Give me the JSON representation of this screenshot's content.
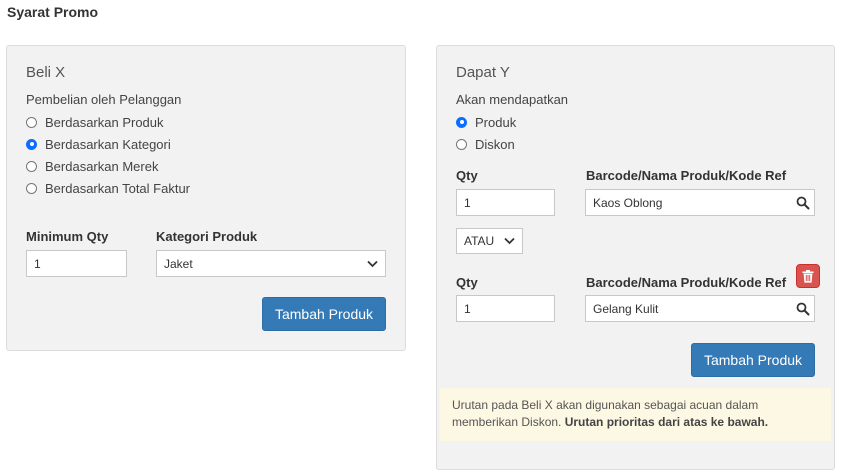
{
  "page": {
    "title": "Syarat Promo"
  },
  "beli_x": {
    "heading": "Beli X",
    "purchase_label": "Pembelian oleh Pelanggan",
    "options": [
      {
        "label": "Berdasarkan Produk",
        "checked": false
      },
      {
        "label": "Berdasarkan Kategori",
        "checked": true
      },
      {
        "label": "Berdasarkan Merek",
        "checked": false
      },
      {
        "label": "Berdasarkan Total Faktur",
        "checked": false
      }
    ],
    "min_qty_label": "Minimum Qty",
    "min_qty_value": "1",
    "category_label": "Kategori Produk",
    "category_value": "Jaket",
    "add_button": "Tambah Produk"
  },
  "dapat_y": {
    "heading": "Dapat Y",
    "receive_label": "Akan mendapatkan",
    "options": [
      {
        "label": "Produk",
        "checked": true
      },
      {
        "label": "Diskon",
        "checked": false
      }
    ],
    "rows": [
      {
        "qty_label": "Qty",
        "qty_value": "1",
        "product_label": "Barcode/Nama Produk/Kode Ref",
        "product_value": "Kaos Oblong"
      },
      {
        "qty_label": "Qty",
        "qty_value": "1",
        "product_label": "Barcode/Nama Produk/Kode Ref",
        "product_value": "Gelang Kulit"
      }
    ],
    "operator_value": "ATAU",
    "add_button": "Tambah Produk",
    "note_text": "Urutan pada Beli X akan digunakan sebagai acuan dalam memberikan Diskon.",
    "note_bold": "Urutan prioritas dari atas ke bawah."
  },
  "colors": {
    "primary": "#337ab7",
    "danger": "#d9534f",
    "panel_bg": "#f2f2f2",
    "note_bg": "#fcf8e3",
    "radio_checked": "#0d6efd"
  },
  "icons": {
    "search": "search-icon",
    "trash": "trash-icon",
    "chevron": "chevron-down-icon"
  }
}
